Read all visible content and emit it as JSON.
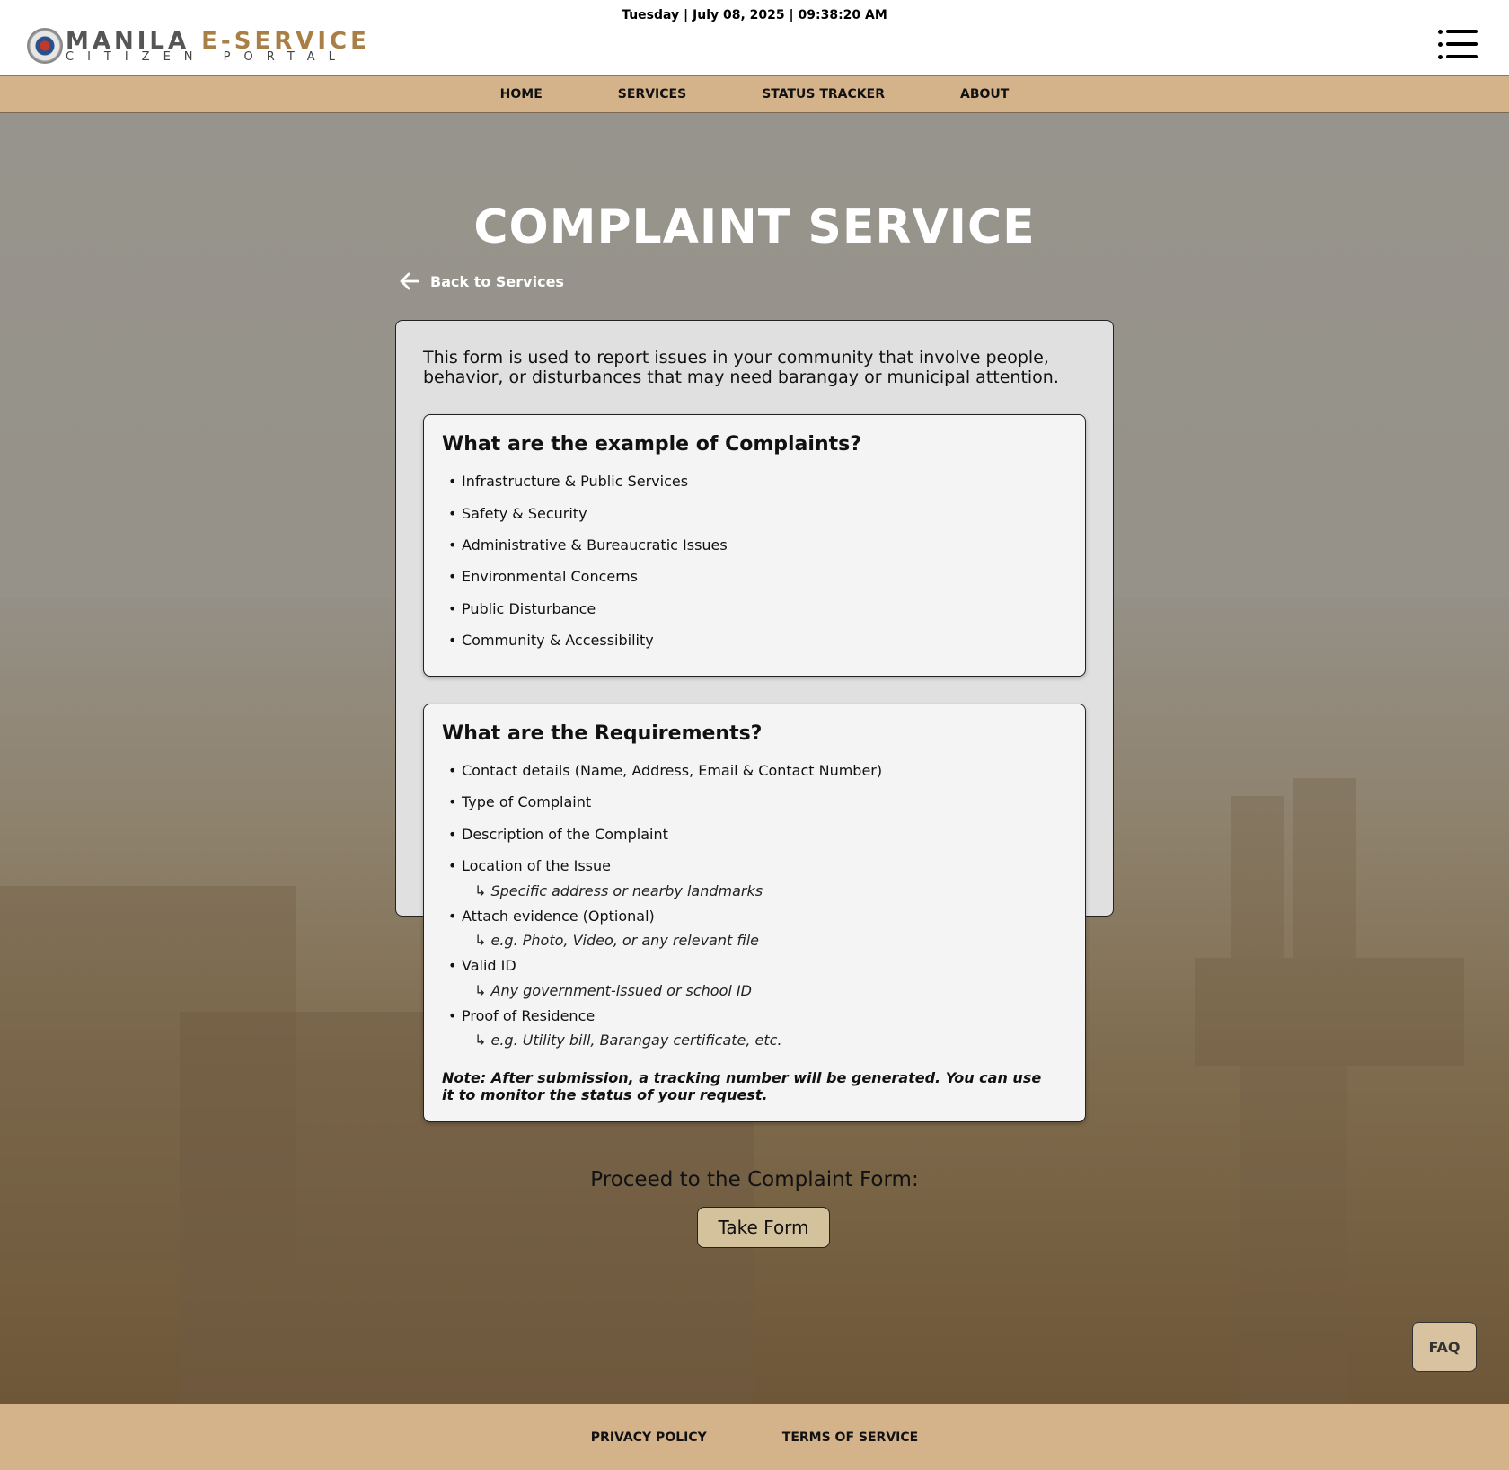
{
  "header": {
    "datetime": "Tuesday | July 08, 2025 | 09:38:20 AM",
    "logo_name_part1": "MANILA ",
    "logo_name_part2": "E-SERVICE",
    "logo_subtitle": "CITIZEN PORTAL"
  },
  "nav": {
    "items": [
      "HOME",
      "SERVICES",
      "STATUS TRACKER",
      "ABOUT"
    ]
  },
  "page": {
    "title": "COMPLAINT SERVICE",
    "back_label": "Back to Services",
    "intro": "This form is used to report issues in your community that involve people, behavior, or disturbances that may need barangay or municipal attention."
  },
  "examples": {
    "heading": "What are the example of Complaints?",
    "items": [
      "Infrastructure & Public Services",
      "Safety & Security",
      "Administrative & Bureaucratic Issues",
      "Environmental Concerns",
      "Public Disturbance",
      "Community & Accessibility"
    ]
  },
  "requirements": {
    "heading": "What are the Requirements?",
    "items": [
      "Contact details (Name, Address, Email & Contact Number)",
      "Type of Complaint",
      "Description of the Complaint",
      "Location of the Issue",
      "Attach evidence (Optional)",
      "Valid ID",
      "Proof of Residence"
    ],
    "sub_notes": [
      "↳ Specific address or nearby landmarks",
      "↳ e.g. Photo, Video, or any relevant file",
      "↳ Any government-issued or school ID",
      "↳ e.g. Utility bill, Barangay certificate, etc."
    ],
    "note": "Note: After submission, a tracking number will be generated. You can use it to monitor the status of your request."
  },
  "cta": {
    "prompt": "Proceed to the Complaint Form:",
    "button_label": "Take Form"
  },
  "faq_label": "FAQ",
  "footer": {
    "links": [
      "PRIVACY POLICY",
      "TERMS OF SERVICE"
    ]
  },
  "colors": {
    "accent": "#d4b38b",
    "button": "#d3c29b",
    "logo_accent": "#a97f45"
  }
}
